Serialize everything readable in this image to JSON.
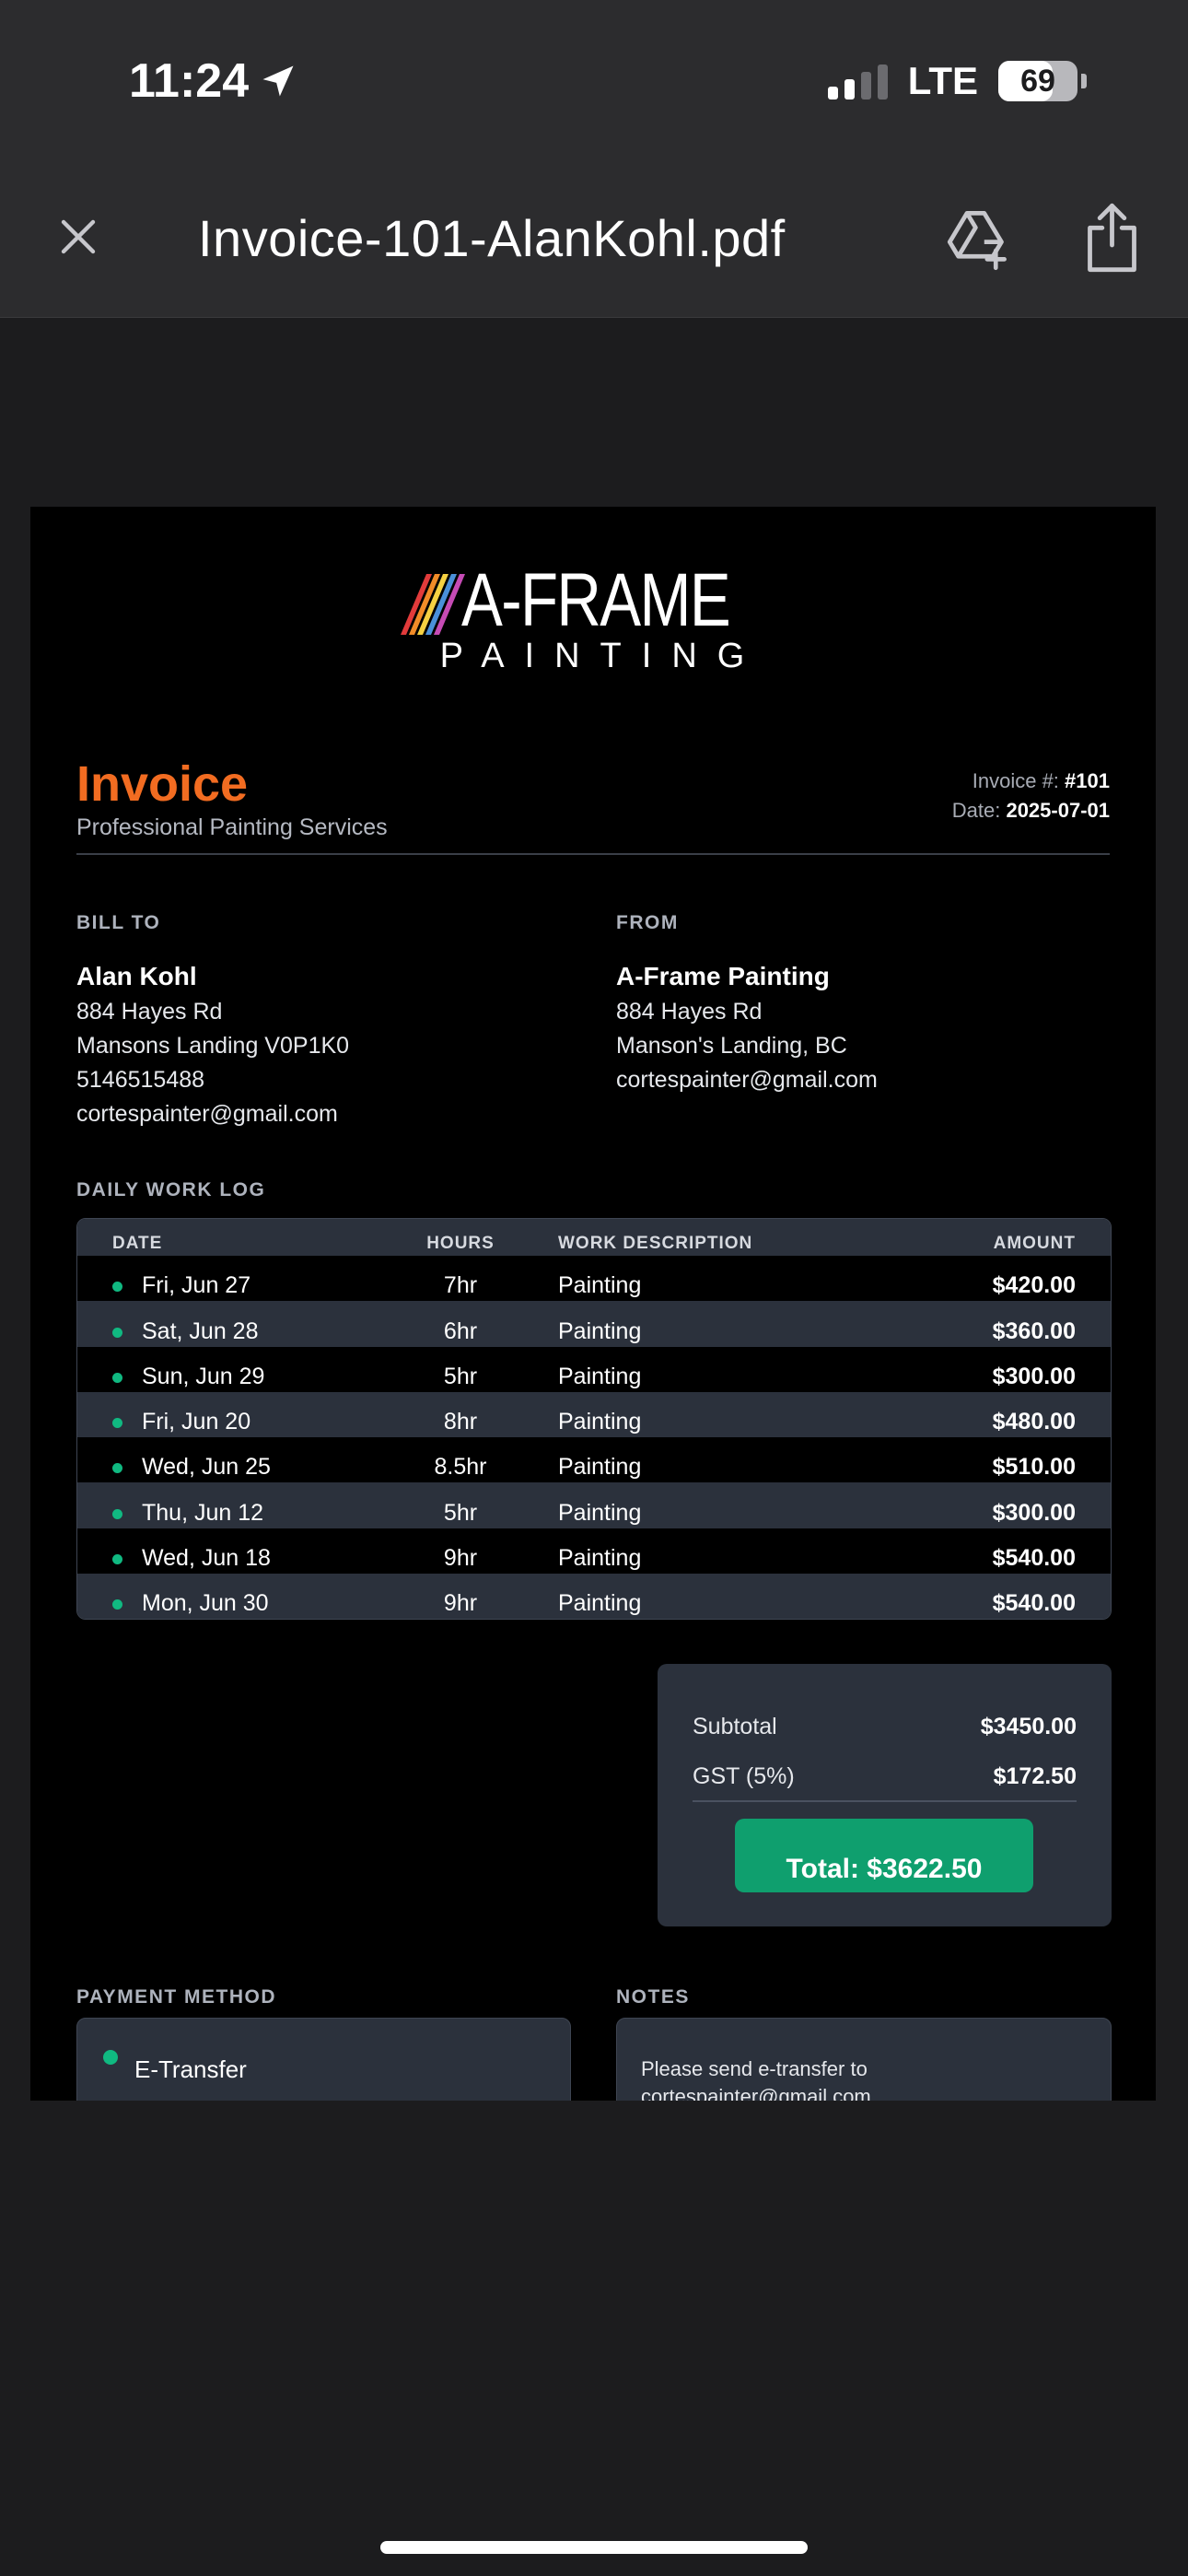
{
  "status_bar": {
    "time": "11:24",
    "network": "LTE",
    "battery": "69",
    "battery_level": 0.69
  },
  "toolbar": {
    "title": "Invoice-101-AlanKohl.pdf",
    "icons": [
      "close-icon",
      "add-to-drive-icon",
      "share-icon"
    ]
  },
  "document": {
    "logo": {
      "word": "A-FRAME",
      "sub": "PAINTING"
    },
    "title": "Invoice",
    "subtitle": "Professional Painting Services",
    "invoice_number_label": "Invoice #:",
    "invoice_number": "#101",
    "date_label": "Date:",
    "date": "2025-07-01",
    "bill_to": {
      "label": "BILL TO",
      "name": "Alan Kohl",
      "lines": [
        "884 Hayes Rd",
        "Mansons Landing V0P1K0",
        "5146515488",
        "cortespainter@gmail.com"
      ]
    },
    "from": {
      "label": "FROM",
      "name": "A-Frame Painting",
      "lines": [
        "884 Hayes Rd",
        "Manson's Landing, BC",
        "cortespainter@gmail.com"
      ]
    },
    "work_log": {
      "label": "DAILY WORK LOG",
      "headers": {
        "date": "DATE",
        "hours": "HOURS",
        "description": "WORK DESCRIPTION",
        "amount": "AMOUNT"
      },
      "rows": [
        {
          "date": "Fri, Jun 27",
          "hours": "7hr",
          "description": "Painting",
          "amount": "$420.00"
        },
        {
          "date": "Sat, Jun 28",
          "hours": "6hr",
          "description": "Painting",
          "amount": "$360.00"
        },
        {
          "date": "Sun, Jun 29",
          "hours": "5hr",
          "description": "Painting",
          "amount": "$300.00"
        },
        {
          "date": "Fri, Jun 20",
          "hours": "8hr",
          "description": "Painting",
          "amount": "$480.00"
        },
        {
          "date": "Wed, Jun 25",
          "hours": "8.5hr",
          "description": "Painting",
          "amount": "$510.00"
        },
        {
          "date": "Thu, Jun 12",
          "hours": "5hr",
          "description": "Painting",
          "amount": "$300.00"
        },
        {
          "date": "Wed, Jun 18",
          "hours": "9hr",
          "description": "Painting",
          "amount": "$540.00"
        },
        {
          "date": "Mon, Jun 30",
          "hours": "9hr",
          "description": "Painting",
          "amount": "$540.00"
        }
      ]
    },
    "totals": {
      "subtotal_label": "Subtotal",
      "subtotal": "$3450.00",
      "gst_label": "GST (5%)",
      "gst": "$172.50",
      "total": "Total: $3622.50"
    },
    "payment": {
      "label": "PAYMENT METHOD",
      "method": "E-Transfer"
    },
    "notes": {
      "label": "NOTES",
      "text": "Please send e-transfer to cortespainter@gmail.com"
    }
  },
  "colors": {
    "accent_orange": "#f26c21",
    "accent_green": "#0f9f6e",
    "dot_green": "#10b981",
    "panel": "#2b313c"
  }
}
